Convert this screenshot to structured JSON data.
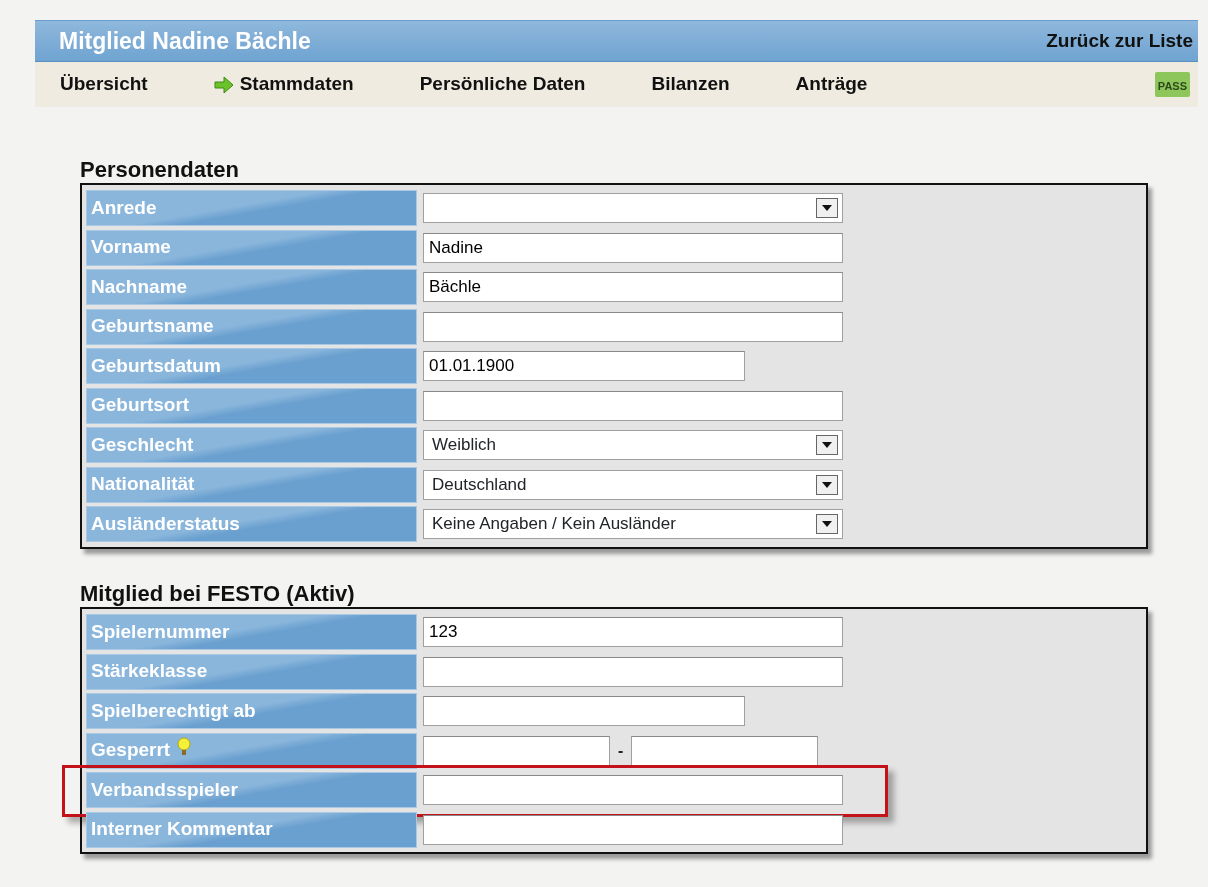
{
  "header": {
    "title": "Mitglied Nadine Bächle",
    "back_link": "Zurück zur Liste"
  },
  "tabs": [
    {
      "label": "Übersicht",
      "selected": false
    },
    {
      "label": "Stammdaten",
      "selected": true
    },
    {
      "label": "Persönliche Daten",
      "selected": false
    },
    {
      "label": "Bilanzen",
      "selected": false
    },
    {
      "label": "Anträge",
      "selected": false
    }
  ],
  "pass_badge": "PASS",
  "sections": [
    {
      "title": "Personendaten",
      "rows": [
        {
          "label": "Anrede",
          "kind": "select"
        },
        {
          "label": "Vorname",
          "kind": "text",
          "value": "Nadine"
        },
        {
          "label": "Nachname",
          "kind": "text",
          "value": "Bächle"
        },
        {
          "label": "Geburtsname",
          "kind": "text"
        },
        {
          "label": "Geburtsdatum",
          "kind": "short",
          "value": "01.01.1900"
        },
        {
          "label": "Geburtsort",
          "kind": "text"
        },
        {
          "label": "Geschlecht",
          "kind": "select",
          "value": "Weiblich"
        },
        {
          "label": "Nationalität",
          "kind": "select",
          "value": "Deutschland"
        },
        {
          "label": "Ausländerstatus",
          "kind": "select",
          "value": "Keine Angaben / Kein Ausländer"
        }
      ]
    },
    {
      "title": "Mitglied bei FESTO (Aktiv)",
      "rows": [
        {
          "label": "Spielernummer",
          "kind": "text",
          "value": "123"
        },
        {
          "label": "Stärkeklasse",
          "kind": "text"
        },
        {
          "label": "Spielberechtigt ab",
          "kind": "short"
        },
        {
          "label": "Gesperrt",
          "kind": "range",
          "hint": true,
          "separator": "-"
        },
        {
          "label": "Verbandsspieler",
          "kind": "text",
          "highlighted": true
        },
        {
          "label": "Interner Kommentar",
          "kind": "text"
        }
      ]
    }
  ]
}
